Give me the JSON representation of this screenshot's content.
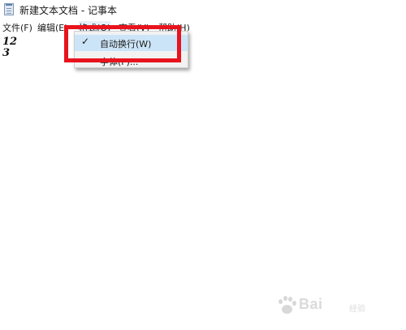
{
  "window": {
    "title": "新建文本文档 - 记事本",
    "icon": "notepad-icon"
  },
  "menubar": {
    "items": [
      {
        "label": "文件(F)"
      },
      {
        "label": "编辑(E)"
      },
      {
        "label": "格式(O)"
      },
      {
        "label": "查看(V)"
      },
      {
        "label": "帮助(H)"
      }
    ]
  },
  "editor": {
    "lines": [
      "12",
      "3"
    ]
  },
  "format_menu": {
    "items": [
      {
        "label": "自动换行(W)",
        "checked": true
      },
      {
        "label": "字体(F)..."
      }
    ]
  },
  "annotation": {
    "highlight_color": "#e8131d"
  },
  "watermark": {
    "text": "Bai",
    "suffix": "经验"
  }
}
